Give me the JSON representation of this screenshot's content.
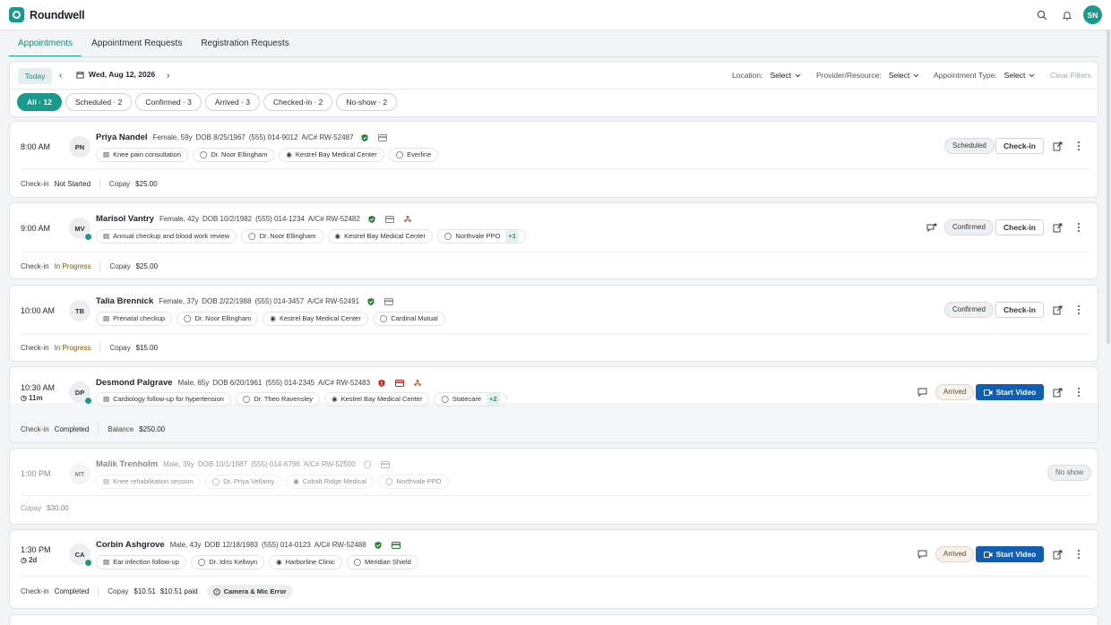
{
  "app": {
    "name": "Roundwell",
    "user_initials": "SN"
  },
  "tabs": [
    {
      "label": "Appointments",
      "active": true
    },
    {
      "label": "Appointment Requests",
      "active": false
    },
    {
      "label": "Registration Requests",
      "active": false
    }
  ],
  "toolbar": {
    "today_label": "Today",
    "date": "Wed, Aug 12, 2026",
    "location_label": "Location:",
    "location_value": "Select",
    "provider_label": "Provider/Resource:",
    "provider_value": "Select",
    "type_label": "Appointment Type:",
    "type_value": "Select",
    "clear_label": "Clear Filters"
  },
  "chips": [
    {
      "label": "All · 12",
      "active": true
    },
    {
      "label": "Scheduled · 2",
      "active": false
    },
    {
      "label": "Confirmed · 3",
      "active": false
    },
    {
      "label": "Arrived · 3",
      "active": false
    },
    {
      "label": "Checked-in · 2",
      "active": false
    },
    {
      "label": "No-show · 2",
      "active": false
    }
  ],
  "colors": {
    "accent": "#1a9a8c",
    "video": "#0f5eb4",
    "shield_green": "#2e7d32",
    "shield_red": "#c62828"
  },
  "appointments": [
    {
      "time": "8:00 AM",
      "initials": "PN",
      "name": "Priya Nandel",
      "demo": "Female, 59y",
      "dob": "DOB 8/25/1967",
      "phone": "(555) 014-9012",
      "acct": "A/C# RW-52487",
      "reason": "Knee pain consultation",
      "provider": "Dr. Noor Ellingham",
      "location": "Kestrel Bay Medical Center",
      "insurance": "Everline",
      "status": "Scheduled",
      "action": "Check-in",
      "checkin_label": "Check-in",
      "checkin_value": "Not Started",
      "amount_label": "Copay",
      "amount_value": "$25.00"
    },
    {
      "time": "9:00 AM",
      "initials": "MV",
      "name": "Marisol Vantry",
      "demo": "Female, 42y",
      "dob": "DOB 10/2/1982",
      "phone": "(555) 014-1234",
      "acct": "A/C# RW-52482",
      "reason": "Annual checkup and blood work review",
      "provider": "Dr. Noor Ellingham",
      "location": "Kestrel Bay Medical Center",
      "insurance": "Northvale PPO",
      "insurance_more": "+1",
      "status": "Confirmed",
      "action": "Check-in",
      "checkin_label": "Check-in",
      "checkin_value": "In Progress",
      "amount_label": "Copay",
      "amount_value": "$25.00"
    },
    {
      "time": "10:00 AM",
      "initials": "TB",
      "name": "Talia Brennick",
      "demo": "Female, 37y",
      "dob": "DOB 2/22/1988",
      "phone": "(555) 014-3457",
      "acct": "A/C# RW-52491",
      "reason": "Prenatal checkup",
      "provider": "Dr. Noor Ellingham",
      "location": "Kestrel Bay Medical Center",
      "insurance": "Cardinal Mutual",
      "status": "Confirmed",
      "action": "Check-in",
      "checkin_label": "Check-in",
      "checkin_value": "In Progress",
      "amount_label": "Copay",
      "amount_value": "$15.00"
    },
    {
      "time": "10:30 AM",
      "wait": "11m",
      "initials": "DP",
      "name": "Desmond Palgrave",
      "demo": "Male, 65y",
      "dob": "DOB 6/20/1961",
      "phone": "(555) 014-2345",
      "acct": "A/C# RW-52483",
      "reason": "Cardiology follow-up for hypertension",
      "provider": "Dr. Theo Ravensley",
      "location": "Kestrel Bay Medical Center",
      "insurance": "Statecare",
      "insurance_more": "+2",
      "status": "Arrived",
      "action": "Start Video",
      "checkin_label": "Check-in",
      "checkin_value": "Completed",
      "amount_label": "Balance",
      "amount_value": "$250.00"
    },
    {
      "time": "1:00 PM",
      "initials": "MT",
      "name": "Malik Trenholm",
      "demo": "Male, 39y",
      "dob": "DOB 10/1/1987",
      "phone": "(555) 014-6796",
      "acct": "A/C# RW-52500",
      "reason": "Knee rehabilitation session",
      "provider": "Dr. Priya Vellamy",
      "location": "Cobalt Ridge Medical",
      "insurance": "Northvale PPO",
      "status": "No show",
      "amount_label": "Copay",
      "amount_value": "$30.00"
    },
    {
      "time": "1:30 PM",
      "wait": "2d",
      "initials": "CA",
      "name": "Corbin Ashgrove",
      "demo": "Male, 43y",
      "dob": "DOB 12/18/1983",
      "phone": "(555) 014-0123",
      "acct": "A/C# RW-52488",
      "reason": "Ear infection follow-up",
      "provider": "Dr. Idris Kellwyn",
      "location": "Harborline Clinic",
      "insurance": "Meridian Shield",
      "status": "Arrived",
      "action": "Start Video",
      "checkin_label": "Check-in",
      "checkin_value": "Completed",
      "amount_label": "Copay",
      "amount_value": "$10.51",
      "paid": "$10.51 paid",
      "error": "Camera & Mic Error"
    }
  ]
}
